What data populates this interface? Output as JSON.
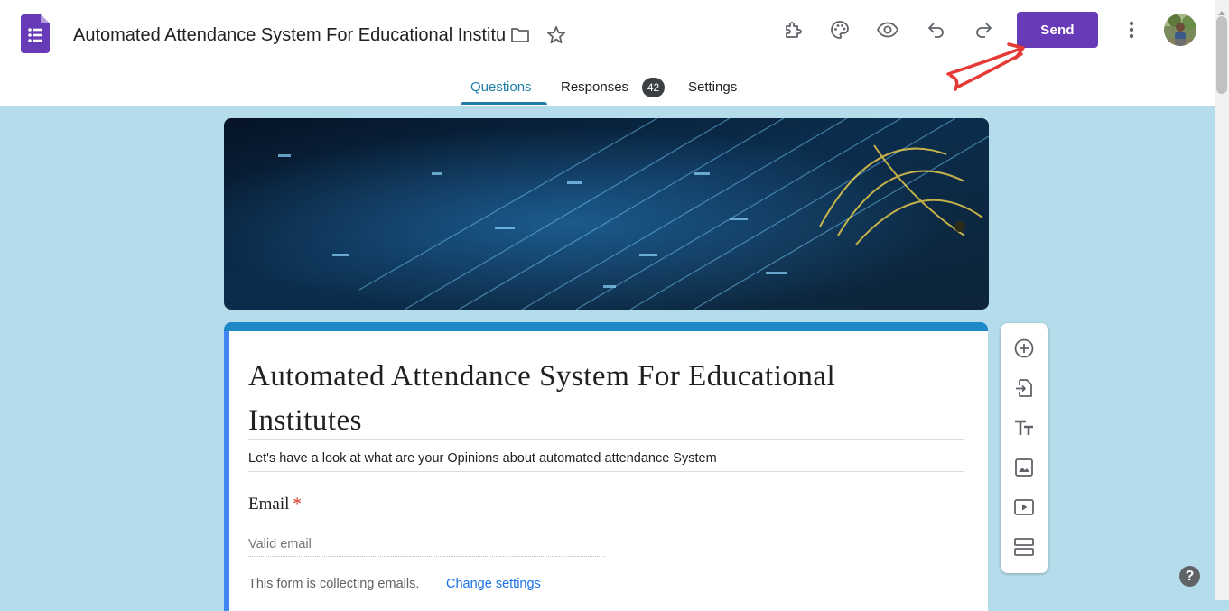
{
  "header": {
    "doc_title": "Automated Attendance System For Educational Institutes",
    "send_label": "Send",
    "icons": [
      "forms-logo",
      "folder-icon",
      "star-icon",
      "addons-icon",
      "palette-icon",
      "preview-eye-icon",
      "undo-icon",
      "redo-icon",
      "more-vert-icon",
      "avatar"
    ]
  },
  "tabs": {
    "questions": "Questions",
    "responses": "Responses",
    "responses_count": "42",
    "settings": "Settings"
  },
  "form": {
    "title": "Automated Attendance System For Educational Institutes",
    "description": "Let's have a look at what are your Opinions about automated attendance System",
    "email_label": "Email",
    "required_mark": "*",
    "email_placeholder": "Valid email",
    "collecting_note": "This form is collecting emails.",
    "change_settings": "Change settings"
  },
  "toolbar": {
    "items": [
      "add-question-icon",
      "import-questions-icon",
      "add-title-icon",
      "add-image-icon",
      "add-video-icon",
      "add-section-icon"
    ]
  },
  "help": "?",
  "colors": {
    "accent": "#673ab7",
    "tab_active": "#1e7ea7",
    "background": "#b4dcea",
    "card_top": "#1e88c7",
    "annotation_arrow": "#e53935"
  }
}
